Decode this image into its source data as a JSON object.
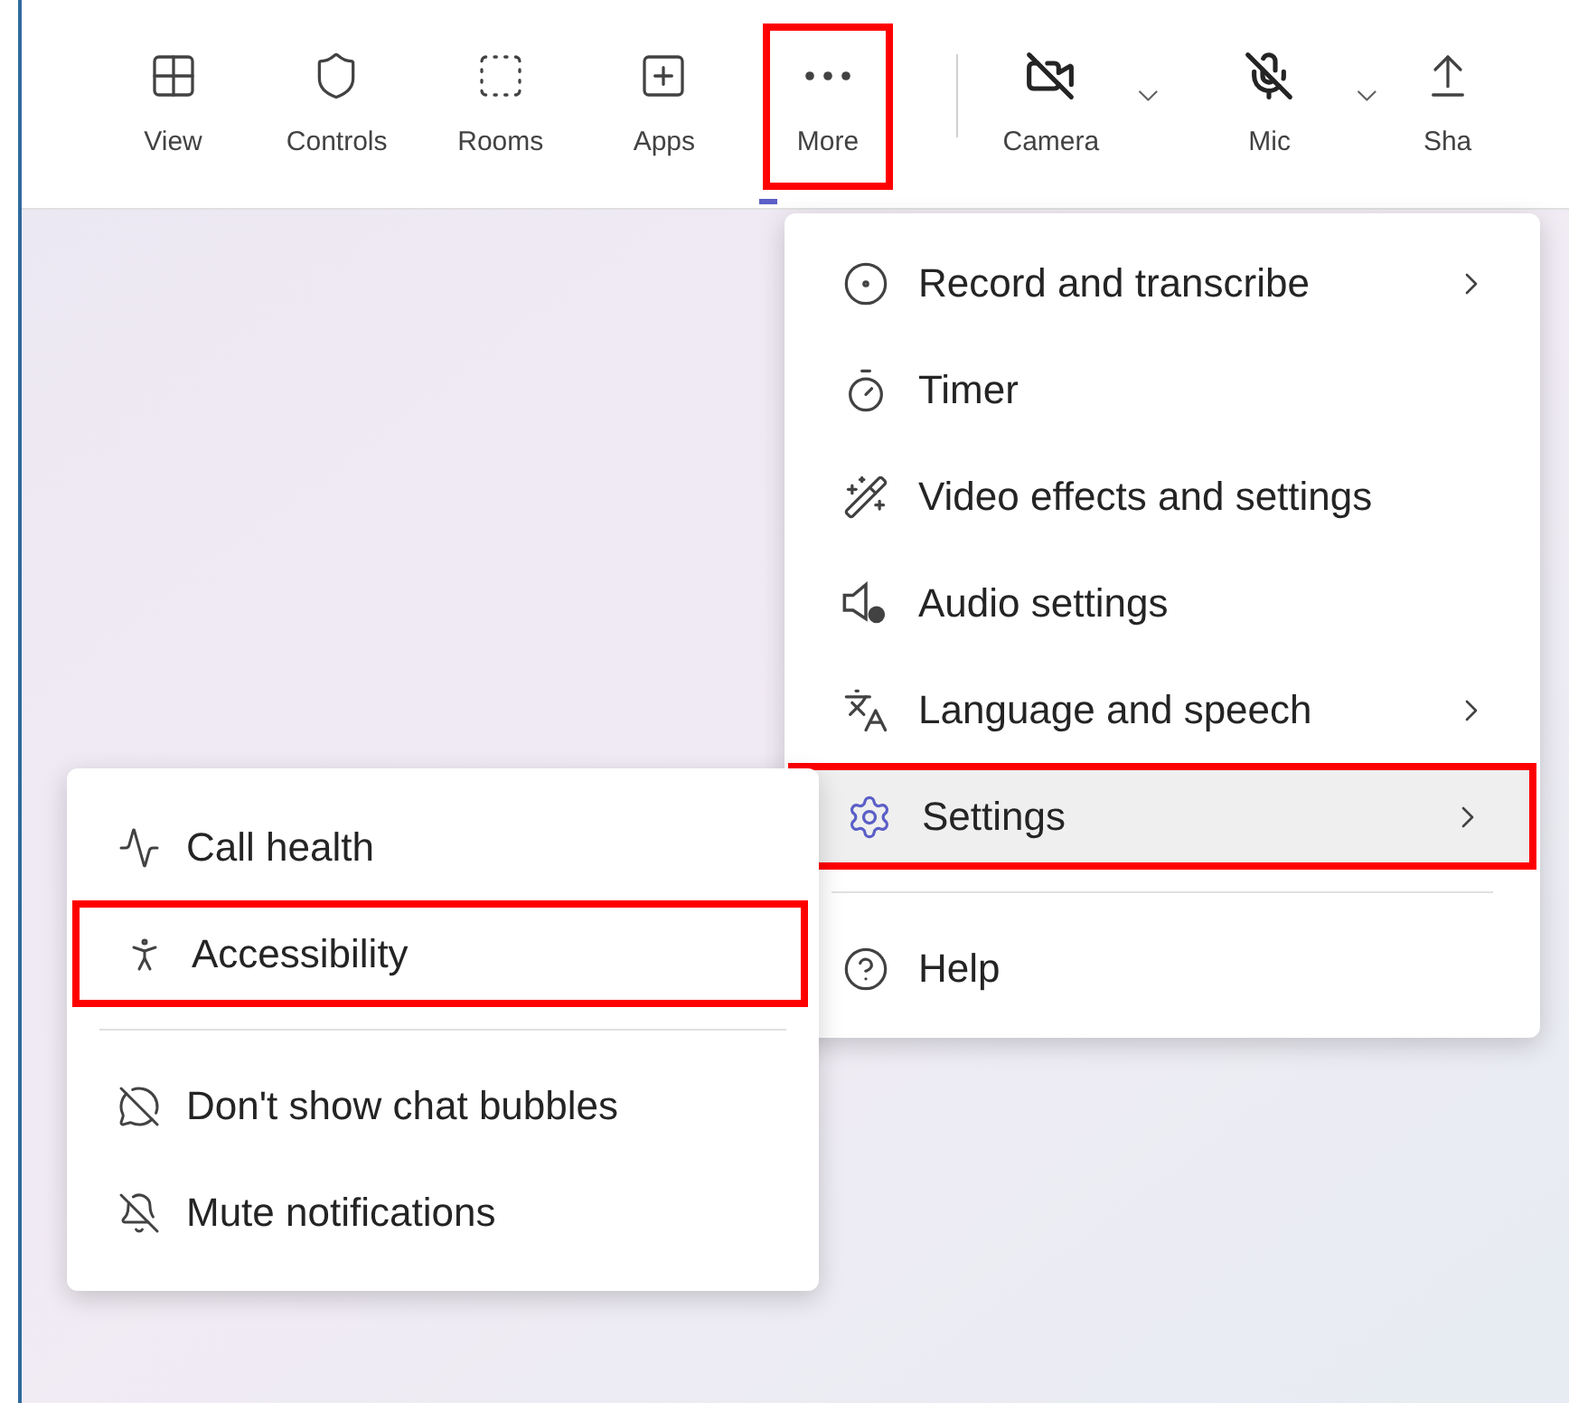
{
  "toolbar": {
    "items": [
      {
        "label": "View",
        "selected": false,
        "highlighted": false,
        "dropdown": false
      },
      {
        "label": "Controls",
        "selected": false,
        "highlighted": false,
        "dropdown": false
      },
      {
        "label": "Rooms",
        "selected": false,
        "highlighted": false,
        "dropdown": false
      },
      {
        "label": "Apps",
        "selected": false,
        "highlighted": false,
        "dropdown": false
      },
      {
        "label": "More",
        "selected": true,
        "highlighted": true,
        "dropdown": false
      },
      {
        "label": "Camera",
        "selected": false,
        "highlighted": false,
        "dropdown": true
      },
      {
        "label": "Mic",
        "selected": false,
        "highlighted": false,
        "dropdown": true
      },
      {
        "label": "Sha",
        "selected": false,
        "highlighted": false,
        "dropdown": false
      }
    ]
  },
  "more_menu": {
    "groups": [
      [
        {
          "label": "Record and transcribe",
          "submenu": true,
          "selected": false,
          "highlighted": false
        },
        {
          "label": "Timer",
          "submenu": false,
          "selected": false,
          "highlighted": false
        },
        {
          "label": "Video effects and settings",
          "submenu": false,
          "selected": false,
          "highlighted": false
        },
        {
          "label": "Audio settings",
          "submenu": false,
          "selected": false,
          "highlighted": false
        },
        {
          "label": "Language and speech",
          "submenu": true,
          "selected": false,
          "highlighted": false
        },
        {
          "label": "Settings",
          "submenu": true,
          "selected": true,
          "highlighted": true
        }
      ],
      [
        {
          "label": "Help",
          "submenu": false,
          "selected": false,
          "highlighted": false
        }
      ]
    ]
  },
  "settings_submenu": {
    "groups": [
      [
        {
          "label": "Call health",
          "selected": false,
          "highlighted": false
        },
        {
          "label": "Accessibility",
          "selected": false,
          "highlighted": true
        }
      ],
      [
        {
          "label": "Don't show chat bubbles",
          "selected": false,
          "highlighted": false
        },
        {
          "label": "Mute notifications",
          "selected": false,
          "highlighted": false
        }
      ]
    ]
  }
}
